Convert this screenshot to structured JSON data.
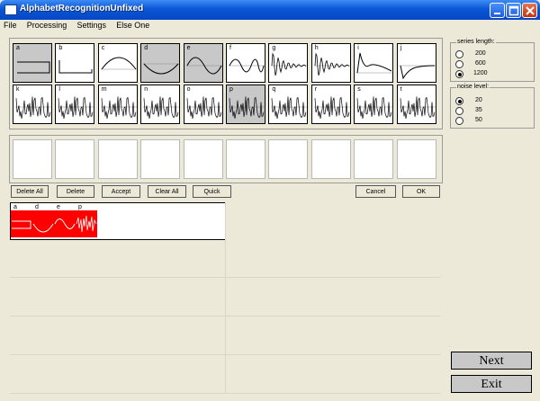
{
  "window": {
    "title": "AlphabetRecognitionUnfixed"
  },
  "menu": [
    "File",
    "Processing",
    "Settings",
    "Else One"
  ],
  "letters_row1": [
    {
      "label": "a",
      "icon": "step-wave-icon",
      "selected": true
    },
    {
      "label": "b",
      "icon": "step-down-icon",
      "selected": false
    },
    {
      "label": "c",
      "icon": "arch-curve-icon",
      "selected": false
    },
    {
      "label": "d",
      "icon": "sine-wave-icon",
      "selected": true
    },
    {
      "label": "e",
      "icon": "full-sine-icon",
      "selected": true
    },
    {
      "label": "f",
      "icon": "chirp-icon",
      "selected": false
    },
    {
      "label": "g",
      "icon": "damped-oscillation-icon",
      "selected": false
    },
    {
      "label": "h",
      "icon": "damped-oscillation-icon",
      "selected": false
    },
    {
      "label": "i",
      "icon": "spike-decay-icon",
      "selected": false
    },
    {
      "label": "j",
      "icon": "dip-decay-icon",
      "selected": false
    }
  ],
  "letters_row2": [
    {
      "label": "k",
      "icon": "noise-icon",
      "selected": false
    },
    {
      "label": "l",
      "icon": "noise-icon",
      "selected": false
    },
    {
      "label": "m",
      "icon": "noise-icon",
      "selected": false
    },
    {
      "label": "n",
      "icon": "noise-icon",
      "selected": false
    },
    {
      "label": "o",
      "icon": "noise-icon",
      "selected": false
    },
    {
      "label": "p",
      "icon": "noise-icon",
      "selected": true
    },
    {
      "label": "q",
      "icon": "noise-icon",
      "selected": false
    },
    {
      "label": "r",
      "icon": "noise-icon",
      "selected": false
    },
    {
      "label": "s",
      "icon": "noise-icon",
      "selected": false
    },
    {
      "label": "t",
      "icon": "noise-icon",
      "selected": false
    }
  ],
  "buttons": {
    "delete_all": "Delete All",
    "delete": "Delete",
    "accept": "Accept",
    "clear_all": "Clear All",
    "quick": "Quick",
    "cancel": "Cancel",
    "ok": "OK"
  },
  "sequence": [
    "a",
    "d",
    "e",
    "p"
  ],
  "series_length": {
    "legend": "series length:",
    "options": [
      "200",
      "600",
      "1200"
    ],
    "selected": "1200"
  },
  "noise_level": {
    "legend": "noise level:",
    "options": [
      "20",
      "35",
      "50"
    ],
    "selected": "20"
  },
  "nav": {
    "next": "Next",
    "exit": "Exit"
  },
  "colors": {
    "selected_cell": "#c8c8c8",
    "sequence_cell": "#ff0000"
  }
}
